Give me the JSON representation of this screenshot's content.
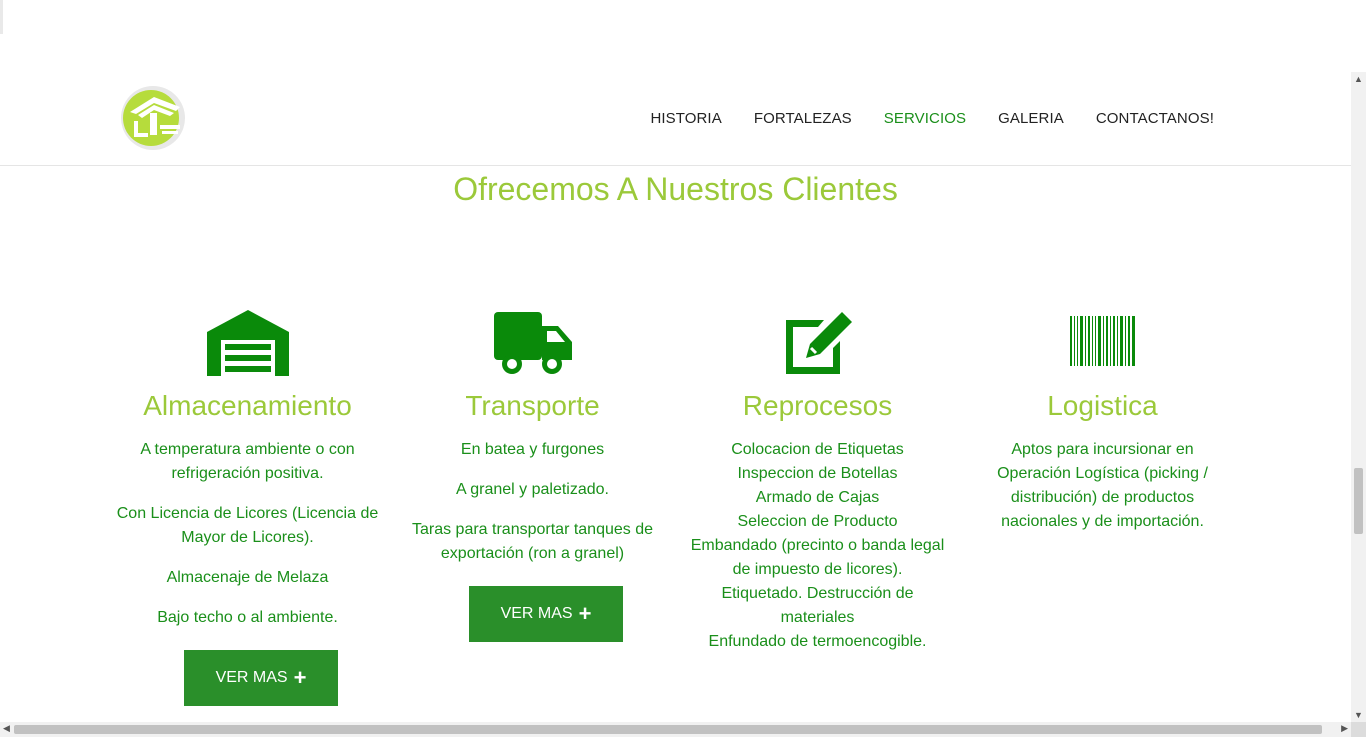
{
  "nav": {
    "items": [
      {
        "label": "HISTORIA",
        "active": false
      },
      {
        "label": "FORTALEZAS",
        "active": false
      },
      {
        "label": "SERVICIOS",
        "active": true
      },
      {
        "label": "GALERIA",
        "active": false
      },
      {
        "label": "CONTACTANOS!",
        "active": false
      }
    ]
  },
  "section": {
    "title": "Ofrecemos A Nuestros Clientes"
  },
  "services": [
    {
      "icon": "warehouse-icon",
      "title": "Almacenamiento",
      "paragraphs": [
        "A temperatura ambiente o con refrigeración positiva.",
        "Con Licencia de Licores (Licencia de Mayor de Licores).",
        "Almacenaje de Melaza",
        "Bajo techo o al ambiente."
      ],
      "button": "VER MAS"
    },
    {
      "icon": "truck-icon",
      "title": "Transporte",
      "paragraphs": [
        "En batea y furgones",
        "A granel y paletizado.",
        "Taras para transportar tanques de exportación (ron a granel)"
      ],
      "button": "VER MAS"
    },
    {
      "icon": "edit-icon",
      "title": "Reprocesos",
      "lines": [
        "Colocacion de Etiquetas",
        "Inspeccion de Botellas",
        "Armado de Cajas",
        "Seleccion de Producto",
        "Embandado (precinto o banda legal de impuesto de licores).",
        "Etiquetado. Destrucción de materiales",
        "Enfundado de termoencogible."
      ]
    },
    {
      "icon": "barcode-icon",
      "title": "Logistica",
      "paragraphs": [
        "Aptos para incursionar en Operación Logística (picking / distribución) de productos nacionales y de importación."
      ]
    }
  ],
  "colors": {
    "accent_green": "#1a8f1a",
    "title_green": "#9bc93a",
    "button_green": "#2a8f2a",
    "icon_green": "#0a8a0a"
  }
}
